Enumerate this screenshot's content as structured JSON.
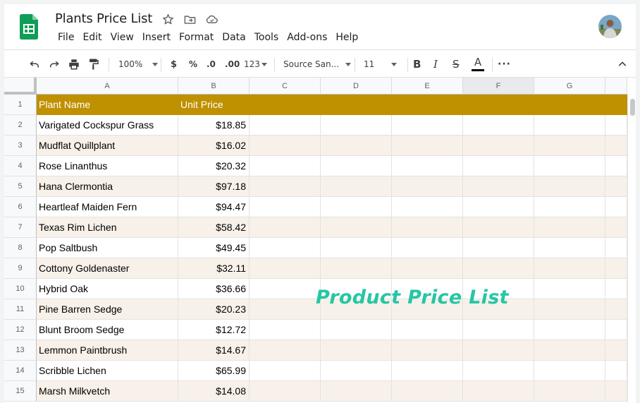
{
  "doc": {
    "title": "Plants Price List"
  },
  "menu": [
    "File",
    "Edit",
    "View",
    "Insert",
    "Format",
    "Data",
    "Tools",
    "Add-ons",
    "Help"
  ],
  "toolbar": {
    "zoom": "100%",
    "currency": "$",
    "percent": "%",
    "dec_decrease": ".0",
    "dec_increase": ".00",
    "more_formats": "123",
    "font": "Source San...",
    "font_size": "11",
    "bold": "B",
    "italic": "I",
    "strike": "S",
    "text_color": "A",
    "more": "···"
  },
  "columns": [
    "A",
    "B",
    "C",
    "D",
    "E",
    "F",
    "G"
  ],
  "selected_column": "F",
  "header_row": {
    "row": "1",
    "a": "Plant Name",
    "b": "Unit Price"
  },
  "rows": [
    {
      "row": "2",
      "name": "Varigated Cockspur Grass",
      "price": "$18.85"
    },
    {
      "row": "3",
      "name": "Mudflat Quillplant",
      "price": "$16.02"
    },
    {
      "row": "4",
      "name": "Rose Linanthus",
      "price": "$20.32"
    },
    {
      "row": "5",
      "name": "Hana Clermontia",
      "price": "$97.18"
    },
    {
      "row": "6",
      "name": "Heartleaf Maiden Fern",
      "price": "$94.47"
    },
    {
      "row": "7",
      "name": "Texas Rim Lichen",
      "price": "$58.42"
    },
    {
      "row": "8",
      "name": "Pop Saltbush",
      "price": "$49.45"
    },
    {
      "row": "9",
      "name": "Cottony Goldenaster",
      "price": "$32.11"
    },
    {
      "row": "10",
      "name": "Hybrid Oak",
      "price": "$36.66"
    },
    {
      "row": "11",
      "name": "Pine Barren Sedge",
      "price": "$20.23"
    },
    {
      "row": "12",
      "name": "Blunt Broom Sedge",
      "price": "$12.72"
    },
    {
      "row": "13",
      "name": "Lemmon Paintbrush",
      "price": "$14.67"
    },
    {
      "row": "14",
      "name": "Scribble Lichen",
      "price": "$65.99"
    },
    {
      "row": "15",
      "name": "Marsh Milkvetch",
      "price": "$14.08"
    }
  ],
  "overlay_text": "Product Price List",
  "colors": {
    "header_fill": "#bf9000",
    "band_fill": "#f8f1e9",
    "overlay": "#26c6a4",
    "sheets_green": "#0f9d58"
  },
  "icons": [
    "sheets-logo-icon",
    "star-icon",
    "move-to-folder-icon",
    "cloud-status-icon",
    "undo-icon",
    "redo-icon",
    "print-icon",
    "paint-format-icon",
    "collapse-chevron-icon"
  ]
}
